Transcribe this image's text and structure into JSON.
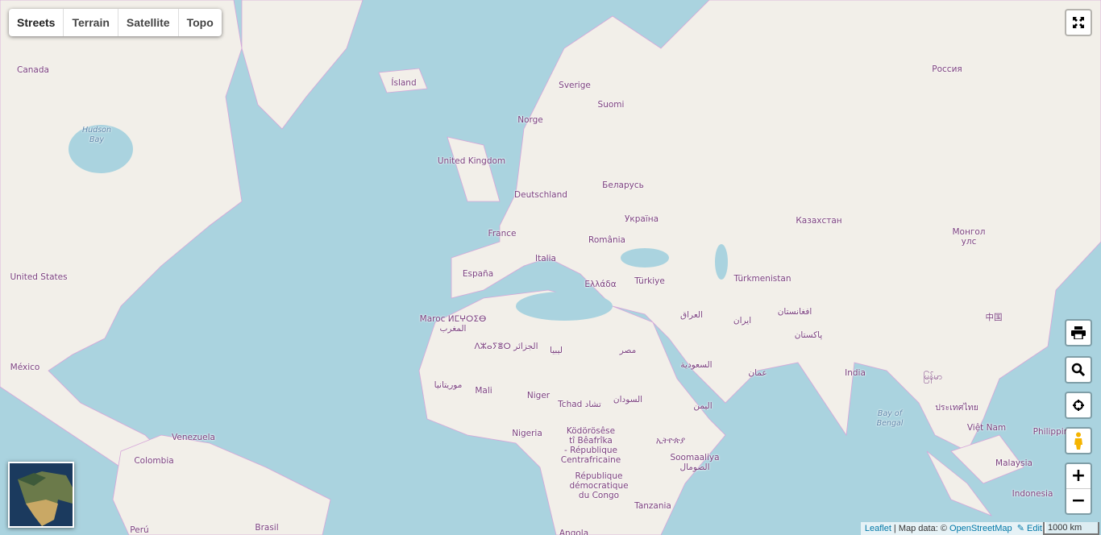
{
  "layer_switcher": {
    "items": [
      "Streets",
      "Terrain",
      "Satellite",
      "Topo"
    ],
    "active": "Streets"
  },
  "controls": {
    "fullscreen_icon": "fullscreen-icon",
    "print_icon": "printer-icon",
    "search_icon": "search-icon",
    "locate_icon": "crosshair-icon",
    "streetview_icon": "pegman-icon",
    "zoom_in": "+",
    "zoom_out": "−"
  },
  "labels": {
    "canada": "Canada",
    "hudson": "Hudson",
    "bay": "Bay",
    "usa": "United States",
    "mexico": "México",
    "venezuela": "Venezuela",
    "colombia": "Colombia",
    "peru": "Perú",
    "brasil": "Brasil",
    "island": "Ísland",
    "sverige": "Sverige",
    "suomi": "Suomi",
    "norge": "Norge",
    "uk": "United Kingdom",
    "deutschland": "Deutschland",
    "belarus": "Беларусь",
    "ukraina": "Україна",
    "france": "France",
    "romania": "România",
    "italia": "Italia",
    "espana": "España",
    "ellada": "Ελλάδα",
    "turkiye": "Türkiye",
    "rossiya": "Россия",
    "kazakhstan": "Казахстан",
    "mongol1": "Монгол",
    "mongol2": "улс",
    "turkmenistan": "Türkmenistan",
    "iraq": "العراق",
    "iran": "ایران",
    "afghanistan": "افغانستان",
    "pakistan": "پاکستان",
    "china": "中国",
    "india": "India",
    "myanmar": "မြန်မာ",
    "bay_of": "Bay of",
    "bengal": "Bengal",
    "thailand": "ประเทศไทย",
    "vietnam": "Việt Nam",
    "philippines": "Philippin",
    "malaysia": "Malaysia",
    "indonesia": "Indonesia",
    "maroc1": "Maroc ⵍⵎⵖⵔⵉⴱ",
    "maroc2": "المغرب",
    "algeria": "ⴷⵣⴰⵢⴻⵔ الجزائر",
    "libya": "ليبيا",
    "egypt": "مصر",
    "saudi": "السعودية",
    "oman": "عمان",
    "yemen": "اليمن",
    "mauritania": "موريتانيا",
    "mali": "Mali",
    "niger": "Niger",
    "tchad": "Tchad تشاد",
    "sudan": "السودان",
    "nigeria": "Nigeria",
    "car1": "Ködörösêse",
    "car2": "tî Bêafrîka",
    "car3": "- République",
    "car4": "Centrafricaine",
    "drc1": "République",
    "drc2": "démocratique",
    "drc3": "du Congo",
    "ethiopia": "ኢትዮጵያ",
    "somalia1": "Soomaaliya",
    "somalia2": "الصومال",
    "tanzania": "Tanzania",
    "angola": "Angola"
  },
  "attribution": {
    "leaflet": "Leaflet",
    "sep": " | Map data: © ",
    "osm": "OpenStreetMap",
    "edit": "✎ Edit"
  },
  "scale": "1000 km",
  "colors": {
    "water": "#aad3df",
    "land": "#f2efe9",
    "border": "#c9a0d4",
    "label": "#7b3f7d"
  }
}
